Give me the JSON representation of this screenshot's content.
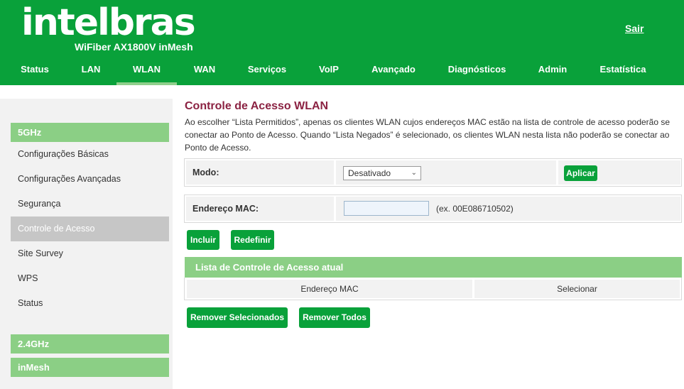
{
  "header": {
    "brand": "intelbras",
    "model": "WiFiber AX1800V inMesh",
    "logout_label": "Sair",
    "nav": [
      "Status",
      "LAN",
      "WLAN",
      "WAN",
      "Serviços",
      "VoIP",
      "Avançado",
      "Diagnósticos",
      "Admin",
      "Estatística"
    ],
    "active_tab": "WLAN"
  },
  "sidebar": {
    "section_5ghz": "5GHz",
    "items": [
      "Configurações Básicas",
      "Configurações Avançadas",
      "Segurança",
      "Controle de Acesso",
      "Site Survey",
      "WPS",
      "Status"
    ],
    "active_item": "Controle de Acesso",
    "section_24ghz": "2.4GHz",
    "section_inmesh": "inMesh"
  },
  "main": {
    "title": "Controle de Acesso WLAN",
    "description": "Ao escolher “Lista Permitidos”, apenas os clientes WLAN cujos endereços MAC estão na lista de controle de acesso poderão se conectar ao Ponto de Acesso. Quando “Lista Negados” é selecionado, os clientes WLAN nesta lista não poderão se conectar ao Ponto de Acesso.",
    "mode_label": "Modo:",
    "mode_value": "Desativado",
    "apply_label": "Aplicar",
    "mac_label": "Endereço MAC:",
    "mac_value": "",
    "mac_hint": "(ex. 00E086710502)",
    "include_label": "Incluir",
    "reset_label": "Redefinir",
    "list_title": "Lista de Controle de Acesso atual",
    "col_mac": "Endereço MAC",
    "col_select": "Selecionar",
    "remove_selected_label": "Remover Selecionados",
    "remove_all_label": "Remover Todos"
  },
  "colors": {
    "brand_green": "#09a13a",
    "light_green": "#8bcf85",
    "title_red": "#8b2242"
  }
}
